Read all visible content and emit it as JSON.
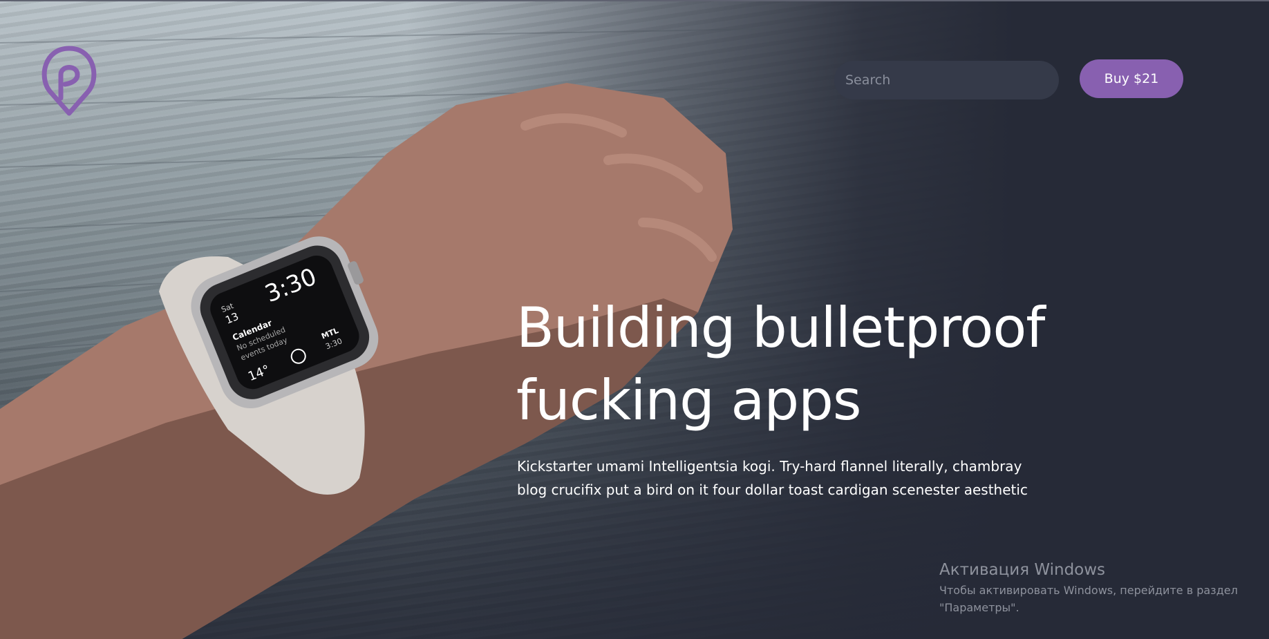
{
  "colors": {
    "accent": "#8860b0",
    "background": "#262a37",
    "search_bg": "#353a49",
    "text": "#ffffff",
    "watermark": "#8e929d"
  },
  "header": {
    "logo_icon": "map-pin-logo-icon",
    "search": {
      "placeholder": "Search",
      "value": ""
    },
    "buy_label": "Buy $21"
  },
  "hero": {
    "headline_line1": "Building bulletproof",
    "headline_line2": "fucking apps",
    "lede_line1": "Kickstarter umami Intelligentsia kogi. Try-hard flannel literally, chambray",
    "lede_line2": "blog crucifix put a bird on it four dollar toast cardigan scenester aesthetic"
  },
  "watch_face": {
    "time": "3:30",
    "day": "Sat",
    "date": "13",
    "event_title": "Calendar",
    "event_line1": "No scheduled",
    "event_line2": "events today",
    "temperature": "14°",
    "city": "MTL",
    "city_time": "3:30"
  },
  "windows_activation": {
    "title": "Активация Windows",
    "line1": "Чтобы активировать Windows, перейдите в раздел",
    "line2": "\"Параметры\"."
  }
}
